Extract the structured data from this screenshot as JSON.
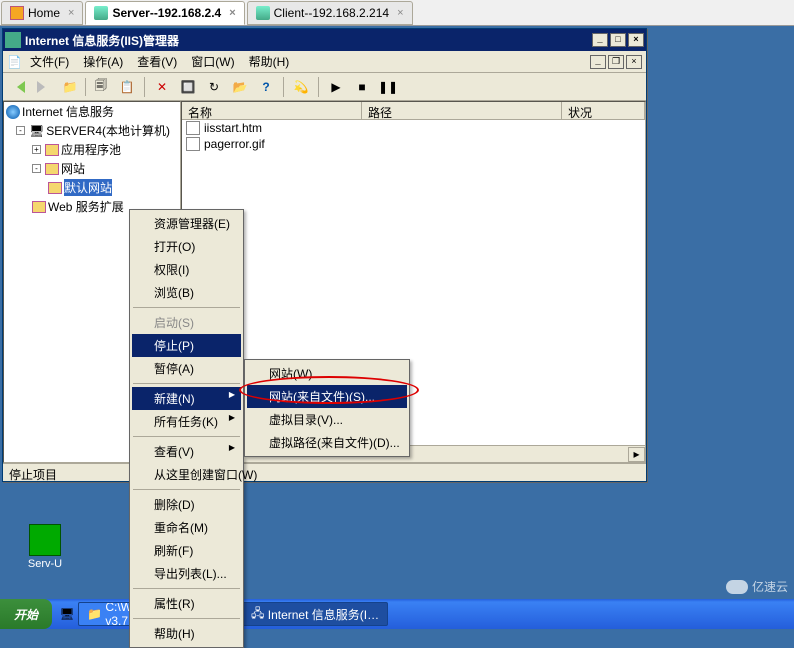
{
  "browser_tabs": {
    "home": "Home",
    "server": "Server--192.168.2.4",
    "client": "Client--192.168.2.214"
  },
  "iis": {
    "title": "Internet 信息服务(IIS)管理器",
    "menus": {
      "file": "文件(F)",
      "action": "操作(A)",
      "view": "查看(V)",
      "window": "窗口(W)",
      "help": "帮助(H)"
    },
    "tree": {
      "root": "Internet 信息服务",
      "server": "SERVER4(本地计算机)",
      "app_pools": "应用程序池",
      "websites": "网站",
      "default_site": "默认网站",
      "web_service_ext": "Web 服务扩展"
    },
    "list": {
      "columns": {
        "name": "名称",
        "path": "路径",
        "status": "状况"
      },
      "rows": [
        {
          "name": "iisstart.htm"
        },
        {
          "name": "pagerror.gif"
        }
      ]
    },
    "status": "停止项目"
  },
  "context_menu_1": {
    "explorer": "资源管理器(E)",
    "open": "打开(O)",
    "permissions": "权限(I)",
    "browse": "浏览(B)",
    "start": "启动(S)",
    "stop": "停止(P)",
    "pause": "暂停(A)",
    "new": "新建(N)",
    "all_tasks": "所有任务(K)",
    "view": "查看(V)",
    "new_window": "从这里创建窗口(W)",
    "delete": "删除(D)",
    "rename": "重命名(M)",
    "refresh": "刷新(F)",
    "export_list": "导出列表(L)...",
    "properties": "属性(R)",
    "help": "帮助(H)"
  },
  "context_menu_2": {
    "website": "网站(W)...",
    "website_from_file": "网站(来自文件)(S)...",
    "virtual_dir": "虚拟目录(V)...",
    "virtual_path_from_file": "虚拟路径(来自文件)(D)..."
  },
  "desktop": {
    "servu": "Serv-U"
  },
  "taskbar": {
    "start": "开始",
    "task1": "C:\\WinWebMail v3.7.1.1",
    "task2": "Internet 信息服务(I…"
  },
  "watermark": "亿速云"
}
